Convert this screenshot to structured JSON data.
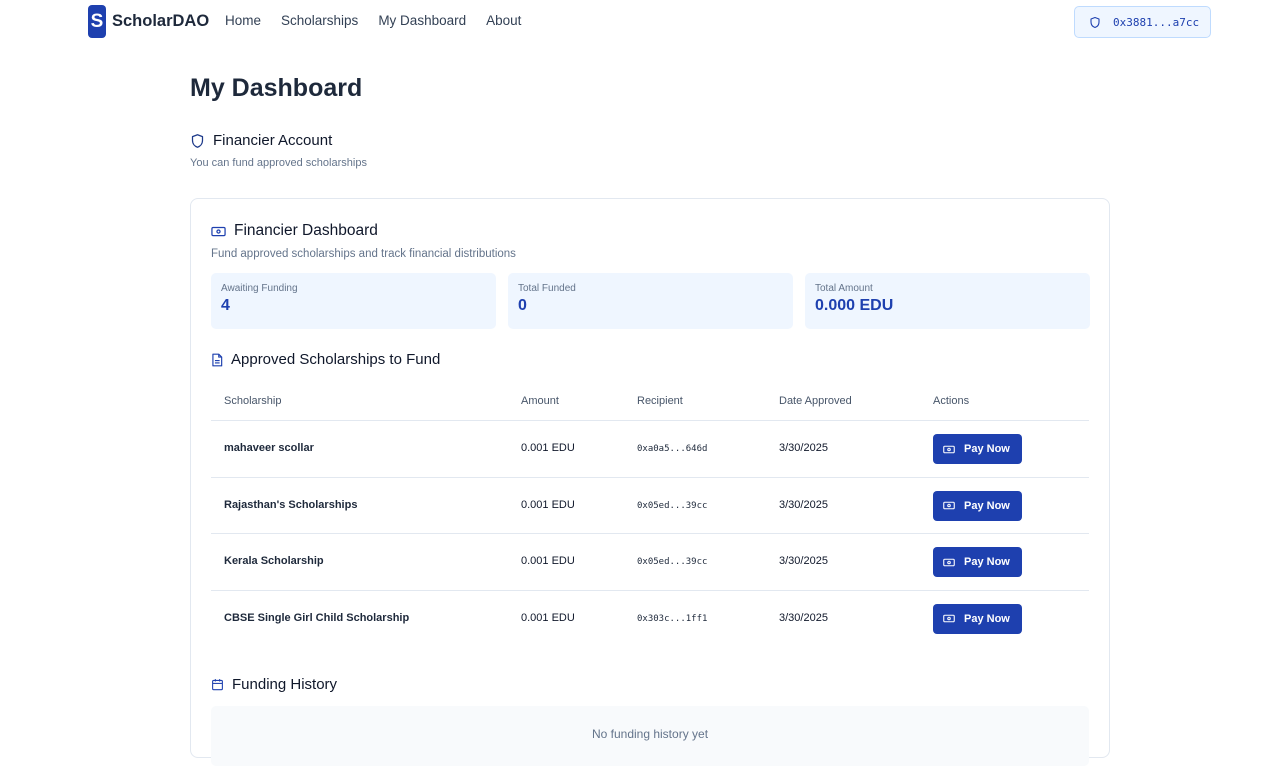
{
  "nav": {
    "logo_letter": "S",
    "logo_text": "ScholarDAO",
    "links": [
      "Home",
      "Scholarships",
      "My Dashboard",
      "About"
    ],
    "wallet": "0x3881...a7cc"
  },
  "page": {
    "title": "My Dashboard",
    "account_title": "Financier Account",
    "account_sub": "You can fund approved scholarships"
  },
  "dashboard": {
    "title": "Financier Dashboard",
    "subtitle": "Fund approved scholarships and track financial distributions",
    "stats": [
      {
        "label": "Awaiting Funding",
        "value": "4"
      },
      {
        "label": "Total Funded",
        "value": "0"
      },
      {
        "label": "Total Amount",
        "value": "0.000 EDU"
      }
    ]
  },
  "approved": {
    "title": "Approved Scholarships to Fund",
    "columns": [
      "Scholarship",
      "Amount",
      "Recipient",
      "Date Approved",
      "Actions"
    ],
    "rows": [
      {
        "name": "mahaveer scollar",
        "amount": "0.001 EDU",
        "recipient": "0xa0a5...646d",
        "date": "3/30/2025",
        "action": "Pay Now"
      },
      {
        "name": "Rajasthan's Scholarships",
        "amount": "0.001 EDU",
        "recipient": "0x05ed...39cc",
        "date": "3/30/2025",
        "action": "Pay Now"
      },
      {
        "name": "Kerala Scholarship",
        "amount": "0.001 EDU",
        "recipient": "0x05ed...39cc",
        "date": "3/30/2025",
        "action": "Pay Now"
      },
      {
        "name": "CBSE Single Girl Child Scholarship",
        "amount": "0.001 EDU",
        "recipient": "0x303c...1ff1",
        "date": "3/30/2025",
        "action": "Pay Now"
      }
    ]
  },
  "history": {
    "title": "Funding History",
    "empty": "No funding history yet"
  },
  "colors": {
    "primary": "#1e40af",
    "stat_bg": "#eff6ff",
    "border": "#e2e8f0"
  }
}
